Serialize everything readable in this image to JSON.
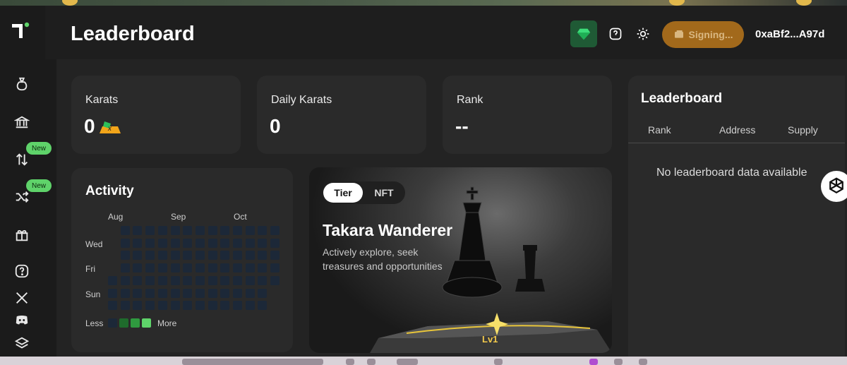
{
  "header": {
    "title": "Leaderboard",
    "signing_label": "Signing...",
    "wallet": "0xaBf2...A97d"
  },
  "sidebar": {
    "badges": [
      "New",
      "New"
    ]
  },
  "stats": [
    {
      "label": "Karats",
      "value": "0",
      "chip": "x"
    },
    {
      "label": "Daily Karats",
      "value": "0"
    },
    {
      "label": "Rank",
      "value": "--"
    }
  ],
  "activity": {
    "title": "Activity",
    "months": [
      "Aug",
      "Sep",
      "Oct"
    ],
    "days": [
      "Wed",
      "Fri",
      "Sun"
    ],
    "legend_less": "Less",
    "legend_more": "More"
  },
  "tier": {
    "tabs": [
      "Tier",
      "NFT"
    ],
    "name": "Takara Wanderer",
    "description": "Actively explore, seek treasures and opportunities",
    "level": "Lv1"
  },
  "leaderboard": {
    "title": "Leaderboard",
    "columns": [
      "Rank",
      "Address",
      "Supply"
    ],
    "empty": "No leaderboard data available"
  },
  "colors": {
    "accent_green": "#5fd36a",
    "signing_bg": "#a2691b",
    "gem_bg": "#1f5a35",
    "level_gold": "#f2c94c"
  }
}
